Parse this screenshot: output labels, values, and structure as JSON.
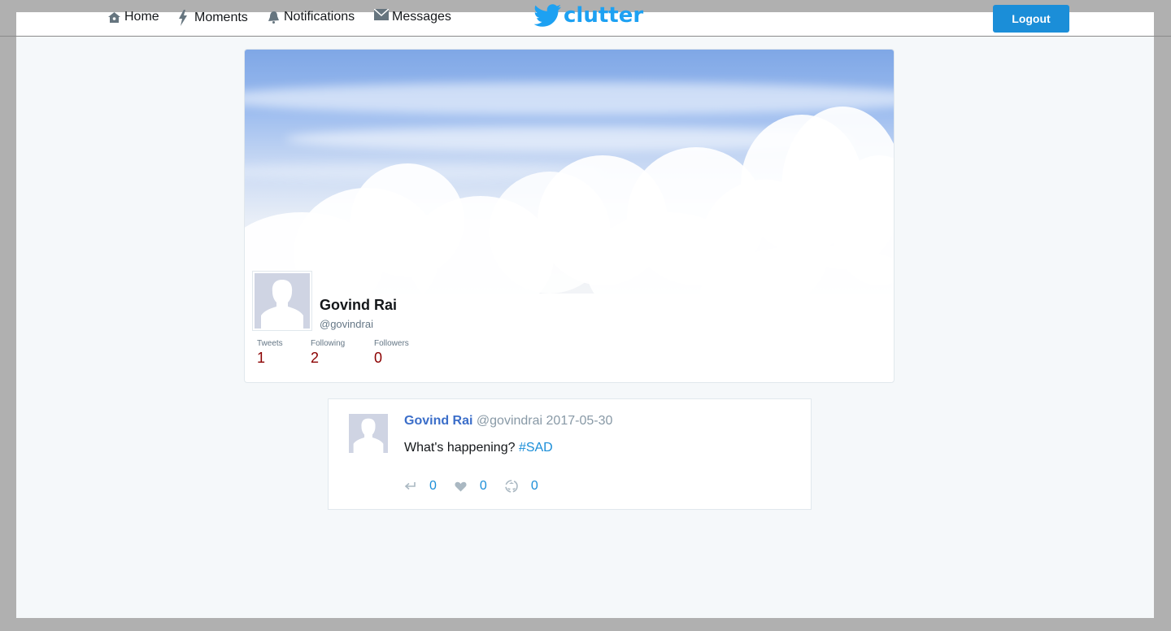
{
  "nav": {
    "items": [
      {
        "label": "Home",
        "icon": "home-icon"
      },
      {
        "label": "Moments",
        "icon": "lightning-icon"
      },
      {
        "label": "Notifications",
        "icon": "bell-icon"
      },
      {
        "label": "Messages",
        "icon": "envelope-icon"
      }
    ],
    "logo_text": "clutter",
    "logout_label": "Logout"
  },
  "profile": {
    "name": "Govind Rai",
    "handle": "@govindrai",
    "stats": [
      {
        "label": "Tweets",
        "value": "1"
      },
      {
        "label": "Following",
        "value": "2"
      },
      {
        "label": "Followers",
        "value": "0"
      }
    ]
  },
  "tweet": {
    "name": "Govind Rai",
    "handle": "@govindrai",
    "date": "2017-05-30",
    "text": "What's happening?",
    "hashtag": "#SAD",
    "reply_count": "0",
    "like_count": "0",
    "retweet_count": "0"
  },
  "colors": {
    "accent": "#1b8ed8",
    "brand": "#1da1f2",
    "stat_value": "#8b0000",
    "name_link": "#3b6ec9"
  }
}
